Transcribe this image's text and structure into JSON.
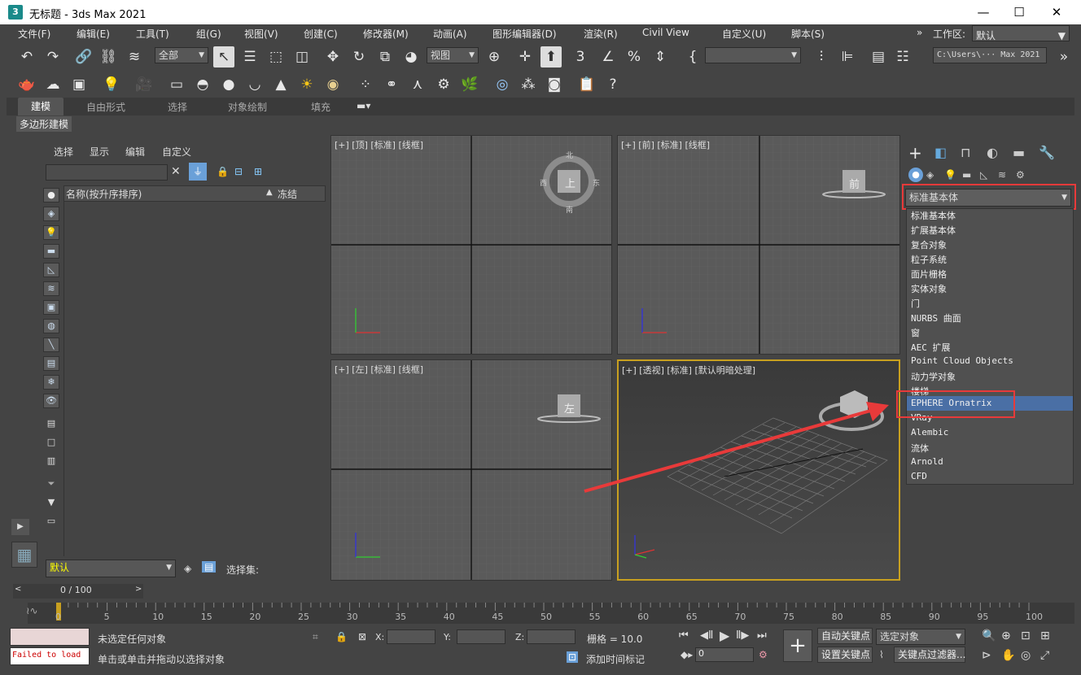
{
  "window": {
    "title": "无标题 - 3ds Max 2021",
    "app_icon": "3"
  },
  "menu": [
    "文件(F)",
    "编辑(E)",
    "工具(T)",
    "组(G)",
    "视图(V)",
    "创建(C)",
    "修改器(M)",
    "动画(A)",
    "图形编辑器(D)",
    "渲染(R)",
    "Civil View",
    "自定义(U)",
    "脚本(S)"
  ],
  "workspace": {
    "label": "工作区:",
    "value": "默认"
  },
  "toolbar": {
    "selection_filter": "全部",
    "ref_coord": "视图",
    "named_sel_set": "",
    "project_path": "C:\\Users\\··· Max 2021"
  },
  "ribbon": {
    "tabs": [
      "建模",
      "自由形式",
      "选择",
      "对象绘制",
      "填充"
    ],
    "subtab": "多边形建模"
  },
  "scene_explorer": {
    "menu": [
      "选择",
      "显示",
      "编辑",
      "自定义"
    ],
    "col_name": "名称(按升序排序)",
    "col_sort": "▲",
    "col_frozen": "冻结",
    "layer": "默认",
    "selset_label": "选择集:"
  },
  "viewports": {
    "top": "[+] [顶] [标准] [线框]",
    "front": "[+] [前] [标准] [线框]",
    "left": "[+] [左] [标准] [线框]",
    "persp": "[+] [透视] [标准] [默认明暗处理]",
    "viewcube_top": "上",
    "viewcube_front": "前",
    "viewcube_left": "左",
    "compass_n": "北",
    "compass_s": "南",
    "compass_e": "东",
    "compass_w": "西"
  },
  "command_panel": {
    "dropdown_value": "标准基本体",
    "types": [
      "标准基本体",
      "扩展基本体",
      "复合对象",
      "粒子系统",
      "面片栅格",
      "实体对象",
      "门",
      "NURBS 曲面",
      "窗",
      "AEC 扩展",
      "Point Cloud Objects",
      "动力学对象",
      "楼梯",
      "EPHERE Ornatrix",
      "VRay",
      "Alembic",
      "流体",
      "Arnold",
      "CFD"
    ],
    "highlighted": "EPHERE Ornatrix"
  },
  "timeline": {
    "frame_display": "0 / 100",
    "ticks": [
      "0",
      "5",
      "10",
      "15",
      "20",
      "25",
      "30",
      "35",
      "40",
      "45",
      "50",
      "55",
      "60",
      "65",
      "70",
      "75",
      "80",
      "85",
      "90",
      "95",
      "100"
    ]
  },
  "status": {
    "maxscript_error": "Failed to load",
    "line1": "未选定任何对象",
    "line2": "单击或单击并拖动以选择对象",
    "x_label": "X:",
    "y_label": "Y:",
    "z_label": "Z:",
    "grid": "栅格 = 10.0",
    "add_time_tag": "添加时间标记",
    "frame_value": "0",
    "auto_key": "自动关键点",
    "set_key": "设置关键点",
    "selected_object": "选定对象",
    "key_filters": "关键点过滤器..."
  },
  "colors": {
    "highlight": "#4a6fa5",
    "annotation": "#e83a3a"
  }
}
